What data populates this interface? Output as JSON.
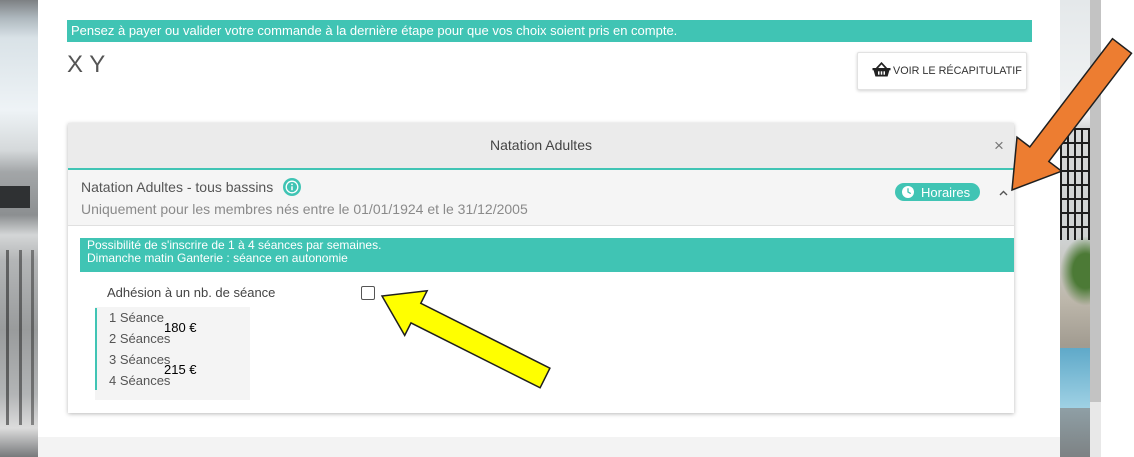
{
  "colors": {
    "accent": "#40c4b4",
    "annotation_orange": "#ed7d31",
    "annotation_yellow": "#ffff00"
  },
  "notice_banner": {
    "text": "Pensez à payer ou valider votre commande à la dernière étape pour que vos choix soient pris en compte."
  },
  "account": {
    "name": "X Y"
  },
  "summary_button": {
    "icon": "basket-icon",
    "label": "VOIR LE RÉCAPITULATIF"
  },
  "activity_card": {
    "title": "Natation Adultes",
    "close_label": "×",
    "activity": {
      "name": "Natation Adultes - tous bassins",
      "info_icon": "info-icon",
      "eligibility": "Uniquement pour les membres nés entre le 01/01/1924 et le 31/12/2005",
      "schedule_button": {
        "icon": "clock-icon",
        "label": "Horaires"
      },
      "toggle_icon": "chevron-up-icon"
    },
    "info_lines": [
      "Possibilité de s'inscrire de 1 à 4 séances par semaines.",
      "Dimanche matin Ganterie : séance en autonomie"
    ],
    "membership_option": {
      "label": "Adhésion à un nb. de séance",
      "checked": false
    },
    "price_tiers": [
      {
        "sessions": [
          "1 Séance",
          "2 Séances"
        ],
        "price": "180 €"
      },
      {
        "sessions": [
          "3 Séances",
          "4 Séances"
        ],
        "price": "215 €"
      }
    ]
  }
}
